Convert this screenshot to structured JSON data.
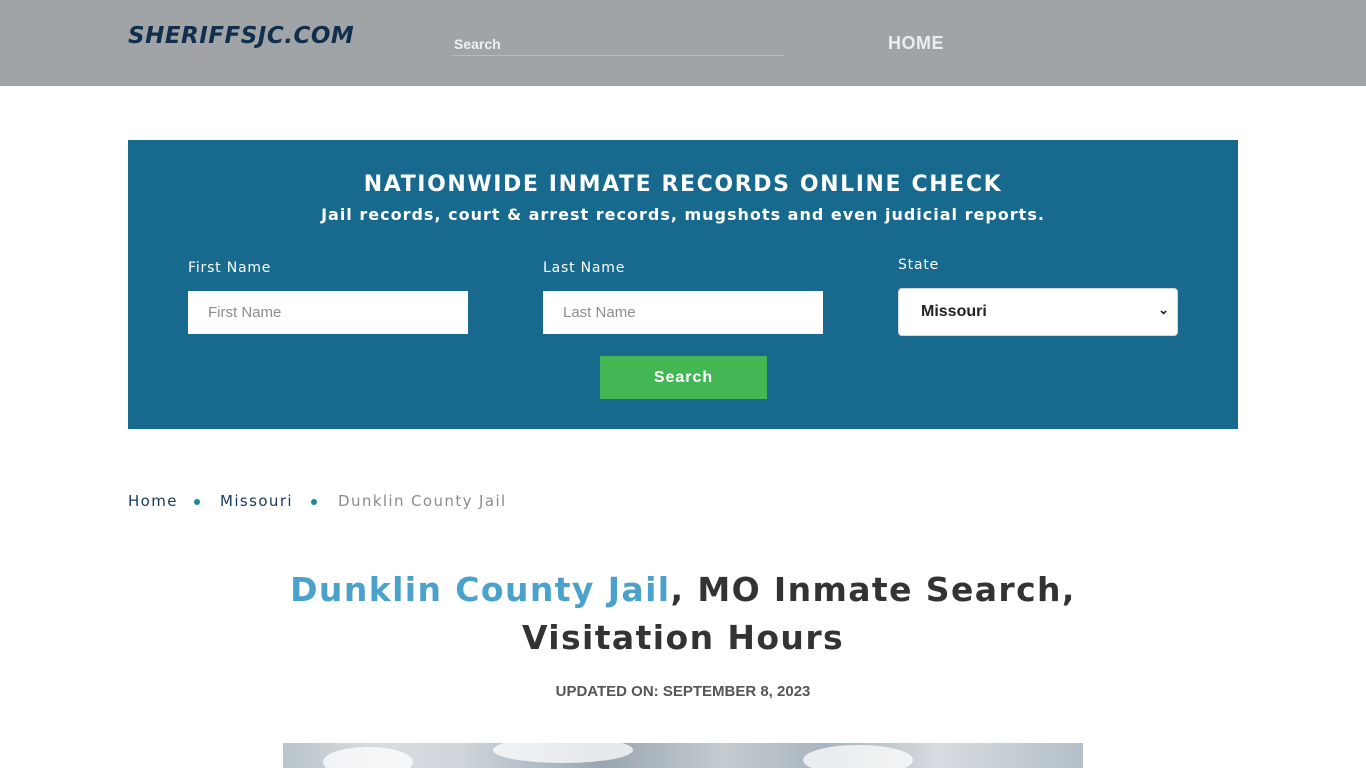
{
  "header": {
    "logo": "SHERIFFSJC.COM",
    "search_placeholder": "Search",
    "nav_home": "HOME"
  },
  "search_panel": {
    "title": "NATIONWIDE INMATE RECORDS ONLINE CHECK",
    "subtitle": "Jail records, court & arrest records, mugshots and even judicial reports.",
    "first_name_label": "First Name",
    "first_name_placeholder": "First Name",
    "last_name_label": "Last Name",
    "last_name_placeholder": "Last Name",
    "state_label": "State",
    "state_selected": "Missouri",
    "search_button": "Search"
  },
  "breadcrumb": {
    "items": [
      "Home",
      "Missouri",
      "Dunklin County Jail"
    ]
  },
  "article": {
    "title_accent": "Dunklin County Jail",
    "title_rest_line1": ", MO Inmate Search,",
    "title_line2": "Visitation Hours",
    "updated": "UPDATED ON: SEPTEMBER 8, 2023"
  },
  "colors": {
    "header_bg": "#a0a4a7",
    "panel_bg": "#17698e",
    "button_bg": "#44b755",
    "title_accent": "#4aa2cc"
  }
}
